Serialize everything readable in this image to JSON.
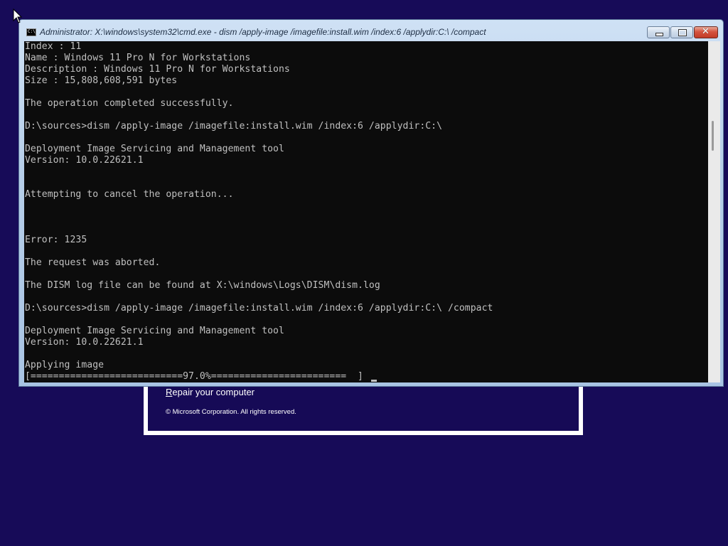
{
  "setup": {
    "repair_label_first": "R",
    "repair_label_rest": "epair your computer",
    "copyright": "© Microsoft Corporation. All rights reserved."
  },
  "cmd": {
    "title": "Administrator: X:\\windows\\system32\\cmd.exe - dism  /apply-image /imagefile:install.wim /index:6 /applydir:C:\\ /compact",
    "icon_text": "C:\\",
    "lines": [
      "Index : 11",
      "Name : Windows 11 Pro N for Workstations",
      "Description : Windows 11 Pro N for Workstations",
      "Size : 15,808,608,591 bytes",
      "",
      "The operation completed successfully.",
      "",
      "D:\\sources>dism /apply-image /imagefile:install.wim /index:6 /applydir:C:\\",
      "",
      "Deployment Image Servicing and Management tool",
      "Version: 10.0.22621.1",
      "",
      "",
      "Attempting to cancel the operation...",
      "",
      "",
      "",
      "Error: 1235",
      "",
      "The request was aborted.",
      "",
      "The DISM log file can be found at X:\\windows\\Logs\\DISM\\dism.log",
      "",
      "D:\\sources>dism /apply-image /imagefile:install.wim /index:6 /applydir:C:\\ /compact",
      "",
      "Deployment Image Servicing and Management tool",
      "Version: 10.0.22621.1",
      "",
      "Applying image",
      "[===========================97.0%========================  ]"
    ],
    "progress_percent": 97.0
  },
  "icons": {
    "minimize": "minimize-icon",
    "maximize": "maximize-icon",
    "close": "close-icon",
    "cmd": "cmd-icon",
    "pointer": "mouse-pointer-icon"
  },
  "colors": {
    "desktop_bg": "#170b58",
    "console_bg": "#0c0c0c",
    "console_fg": "#c0c0c0",
    "close_button": "#c23b26"
  }
}
